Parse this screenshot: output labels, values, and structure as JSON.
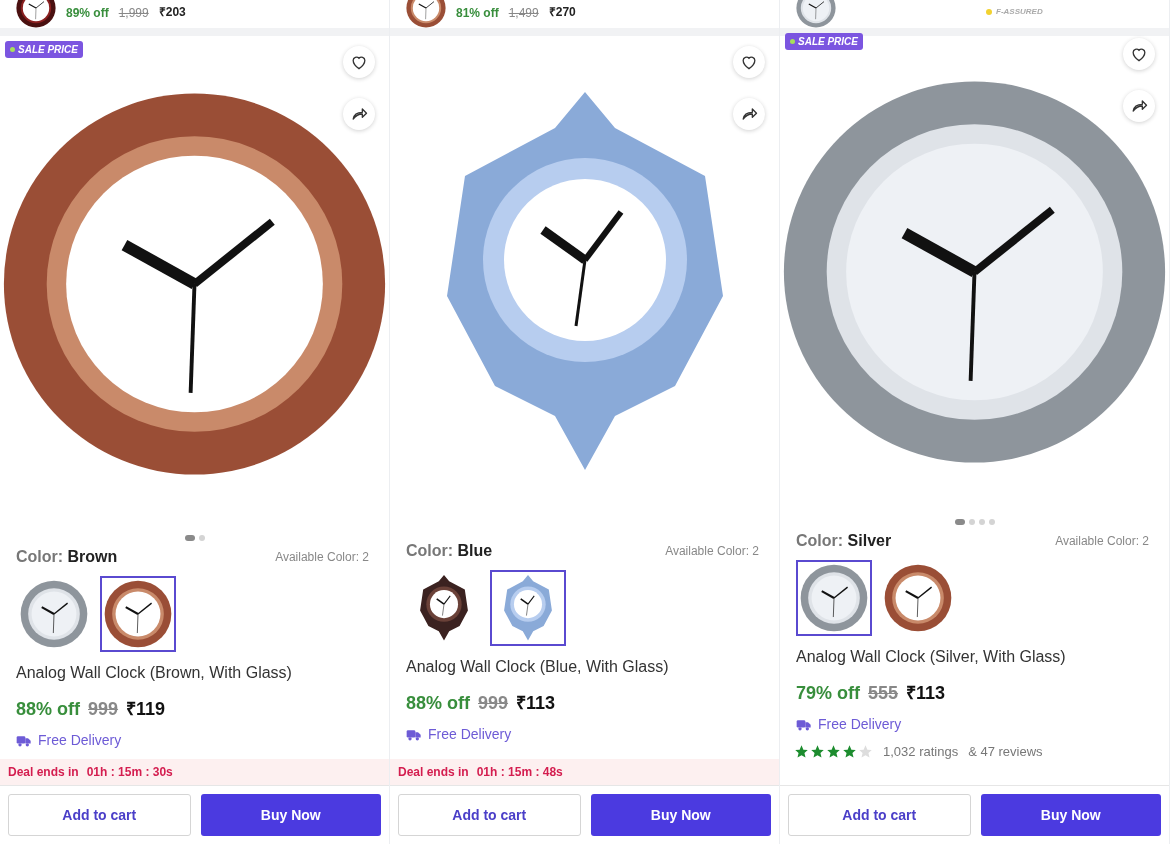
{
  "columns": [
    {
      "top_card": {
        "thumb": {
          "kind": "dark"
        },
        "discount": "89% off",
        "mrp": "1,999",
        "price": "₹203"
      },
      "sale_badge": "SALE PRICE",
      "photo": {
        "kind": "brown"
      },
      "image_dots": [
        {
          "selected": true
        },
        {
          "selected": false
        }
      ],
      "color_label": "Color:",
      "color_value": "Brown",
      "available": "Available Color: 2",
      "swatches": [
        {
          "kind": "silver",
          "selected": false
        },
        {
          "kind": "brown",
          "selected": true
        }
      ],
      "title": "Analog Wall Clock (Brown, With Glass)",
      "discount": "88% off",
      "mrp": "999",
      "price": "₹119",
      "delivery": "Free Delivery",
      "deal": {
        "label": "Deal ends in",
        "time": "01h : 15m : 30s"
      },
      "cart_button": "Add to cart",
      "buy_button": "Buy Now"
    },
    {
      "top_card": {
        "thumb": {
          "kind": "brown"
        },
        "discount": "81% off",
        "mrp": "1,499",
        "price": "₹270"
      },
      "photo": {
        "kind": "anchor"
      },
      "color_label": "Color:",
      "color_value": "Blue",
      "available": "Available Color: 2",
      "swatches": [
        {
          "kind": "darkanchor",
          "selected": false
        },
        {
          "kind": "anchor",
          "selected": true
        }
      ],
      "title": "Analog Wall Clock (Blue, With Glass)",
      "discount": "88% off",
      "mrp": "999",
      "price": "₹113",
      "delivery": "Free Delivery",
      "deal": {
        "label": "Deal ends in",
        "time": "01h : 15m : 48s"
      },
      "cart_button": "Add to cart",
      "buy_button": "Buy Now"
    },
    {
      "top_card": {
        "thumb": {
          "kind": "silver"
        },
        "badge": "F-ASSURED"
      },
      "sale_badge": "SALE PRICE",
      "photo": {
        "kind": "silver"
      },
      "image_dots": [
        {
          "selected": true
        },
        {
          "selected": false
        },
        {
          "selected": false
        },
        {
          "selected": false
        }
      ],
      "color_label": "Color:",
      "color_value": "Silver",
      "available": "Available Color: 2",
      "swatches": [
        {
          "kind": "silver",
          "selected": true
        },
        {
          "kind": "brown",
          "selected": false
        }
      ],
      "title": "Analog Wall Clock (Silver, With Glass)",
      "discount": "79% off",
      "mrp": "555",
      "price": "₹113",
      "delivery": "Free Delivery",
      "rating": {
        "stars": 4,
        "ratings": "1,032 ratings",
        "reviews": "& 47 reviews"
      },
      "cart_button": "Add to cart",
      "buy_button": "Buy Now"
    }
  ]
}
